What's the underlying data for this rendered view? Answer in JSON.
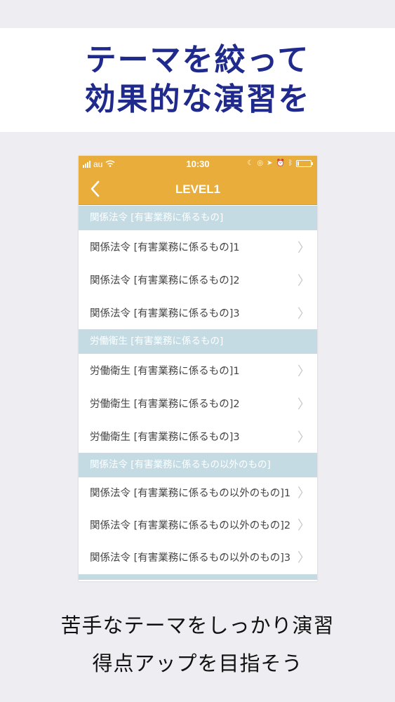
{
  "headline": {
    "line1": "テーマを絞って",
    "line2": "効果的な演習を",
    "color": "#1f2a8c"
  },
  "statusbar": {
    "carrier": "au",
    "time": "10:30",
    "battery_level": 0.1
  },
  "navbar": {
    "back_icon": "chevron-left-icon",
    "title": "LEVEL1",
    "color": "#e9ad3c"
  },
  "sections": [
    {
      "header": "関係法令 [有害業務に係るもの]",
      "rows": [
        {
          "label": "関係法令 [有害業務に係るもの]1"
        },
        {
          "label": "関係法令 [有害業務に係るもの]2"
        },
        {
          "label": "関係法令 [有害業務に係るもの]3"
        }
      ]
    },
    {
      "header": "労働衛生 [有害業務に係るもの]",
      "rows": [
        {
          "label": "労働衛生 [有害業務に係るもの]1"
        },
        {
          "label": "労働衛生 [有害業務に係るもの]2"
        },
        {
          "label": "労働衛生 [有害業務に係るもの]3"
        }
      ]
    },
    {
      "header": "関係法令 [有害業務に係るもの以外のもの]",
      "rows": [
        {
          "label": "関係法令 [有害業務に係るもの以外のもの]1"
        },
        {
          "label": "関係法令 [有害業務に係るもの以外のもの]2"
        },
        {
          "label": "関係法令 [有害業務に係るもの以外のもの]3"
        }
      ]
    }
  ],
  "caption": {
    "line1": "苦手なテーマをしっかり演習",
    "line2": "得点アップを目指そう"
  }
}
